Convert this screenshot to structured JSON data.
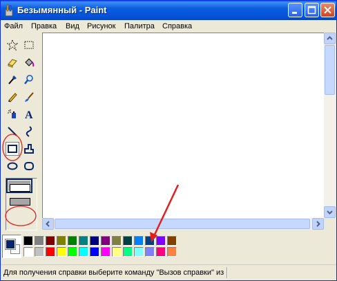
{
  "window": {
    "title": "Безымянный - Paint"
  },
  "menu": [
    "Файл",
    "Правка",
    "Вид",
    "Рисунок",
    "Палитра",
    "Справка"
  ],
  "tools": [
    {
      "name": "free-form-select",
      "icon": "star-select-icon"
    },
    {
      "name": "rect-select",
      "icon": "rect-select-icon"
    },
    {
      "name": "eraser",
      "icon": "eraser-icon"
    },
    {
      "name": "fill",
      "icon": "paint-bucket-icon"
    },
    {
      "name": "pick-color",
      "icon": "eyedropper-icon"
    },
    {
      "name": "magnifier",
      "icon": "magnifier-icon"
    },
    {
      "name": "pencil",
      "icon": "pencil-icon"
    },
    {
      "name": "brush",
      "icon": "brush-icon"
    },
    {
      "name": "airbrush",
      "icon": "airbrush-icon"
    },
    {
      "name": "text",
      "icon": "text-icon"
    },
    {
      "name": "line",
      "icon": "line-icon"
    },
    {
      "name": "curve",
      "icon": "curve-icon"
    },
    {
      "name": "rectangle",
      "icon": "rectangle-icon",
      "selected": true
    },
    {
      "name": "polygon",
      "icon": "polygon-icon"
    },
    {
      "name": "ellipse",
      "icon": "ellipse-icon"
    },
    {
      "name": "rounded-rectangle",
      "icon": "rounded-rect-icon"
    }
  ],
  "text_tool_glyph": "A",
  "fill_options": [
    "outline",
    "outline-fill",
    "fill"
  ],
  "palette": {
    "foreground": "#0a246a",
    "background": "#ffffff",
    "top_row": [
      "#000000",
      "#808080",
      "#800000",
      "#808000",
      "#008000",
      "#008080",
      "#000080",
      "#800080",
      "#808040",
      "#004040",
      "#0080ff",
      "#004080",
      "#8000ff",
      "#804000"
    ],
    "bottom_row": [
      "#ffffff",
      "#c0c0c0",
      "#ff0000",
      "#ffff00",
      "#00ff00",
      "#00ffff",
      "#0000ff",
      "#ff00ff",
      "#ffff80",
      "#00ff80",
      "#80ffff",
      "#8080ff",
      "#ff0080",
      "#ff8040"
    ]
  },
  "status": {
    "text": "Для получения справки выберите команду \"Вызов справки\" из"
  },
  "annotations": {
    "color": "#e02020"
  }
}
